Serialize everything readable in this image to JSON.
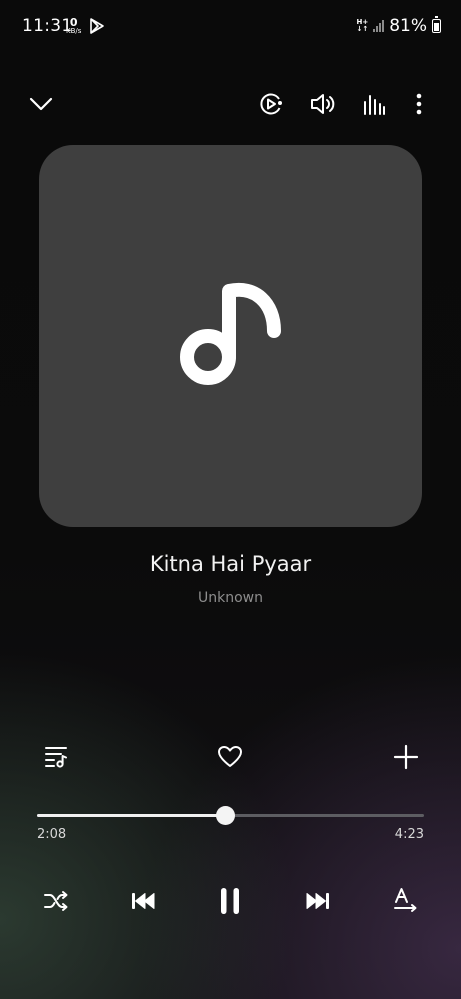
{
  "status_bar": {
    "time": "11:31",
    "data_speed": "0",
    "data_unit": "KB/s",
    "network_type": "H+",
    "battery": "81%"
  },
  "now_playing": {
    "title": "Kitna Hai Pyaar",
    "artist": "Unknown",
    "elapsed": "2:08",
    "duration": "4:23",
    "progress": 0.488
  },
  "icons": {
    "collapse": "chevron-down-icon",
    "visualizer": "play-cycle-icon",
    "volume": "volume-icon",
    "equalizer": "equalizer-icon",
    "more": "more-vertical-icon",
    "playlist": "playlist-icon",
    "favorite": "heart-icon",
    "add": "plus-icon",
    "shuffle": "shuffle-icon",
    "previous": "skip-previous-icon",
    "pause": "pause-icon",
    "next": "skip-next-icon",
    "lyrics": "lyrics-icon"
  },
  "colors": {
    "album_bg": "#3f3f3f",
    "accent": "#ffffff",
    "muted_text": "#8d8d8d"
  }
}
